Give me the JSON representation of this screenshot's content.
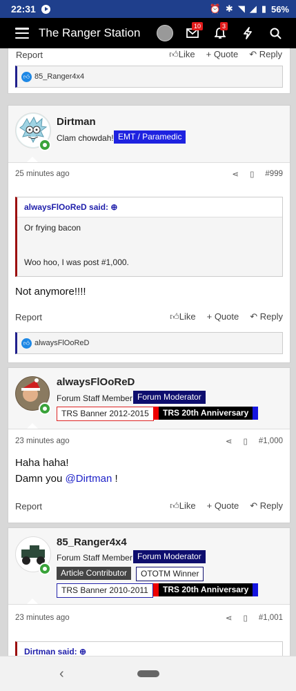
{
  "status": {
    "time": "22:31",
    "battery": "56%"
  },
  "app": {
    "title": "The Ranger Station",
    "inbox_count": "10",
    "alerts_count": "3"
  },
  "actions": {
    "report": "Report",
    "like": "Like",
    "quote": "+ Quote",
    "reply": "Reply"
  },
  "top_post": {
    "reaction_user": "85_Ranger4x4"
  },
  "post1": {
    "username": "Dirtman",
    "user_title": "Clam chowdah!",
    "banner": "EMT / Paramedic",
    "time": "25 minutes ago",
    "number": "#999",
    "quote_author": "alwaysFlOoReD said:",
    "quote_line1": "Or frying bacon",
    "quote_line2": "Woo hoo, I was post #1,000.",
    "message": "Not anymore!!!!",
    "reaction_user": "alwaysFlOoReD"
  },
  "post2": {
    "username": "alwaysFlOoReD",
    "user_title": "Forum Staff Member",
    "banner_moderator": "Forum Moderator",
    "banner_trs": "TRS Banner 2012-2015",
    "banner_anniv": "TRS 20th Anniversary",
    "time": "23 minutes ago",
    "number": "#1,000",
    "message_line1": "Haha haha!",
    "message_line2_pre": "Damn you ",
    "mention": "@Dirtman",
    "message_line2_post": " !"
  },
  "post3": {
    "username": "85_Ranger4x4",
    "user_title": "Forum Staff Member",
    "banner_moderator": "Forum Moderator",
    "banner_contributor": "Article Contributor",
    "banner_ototm": "OTOTM Winner",
    "banner_trs": "TRS Banner 2010-2011",
    "banner_anniv": "TRS 20th Anniversary",
    "time": "23 minutes ago",
    "number": "#1,001",
    "quote_author": "Dirtman said:"
  },
  "colors": {
    "accent": "#1e22e0",
    "appbar": "#000000",
    "statusbar": "#1f3f8c",
    "quote_border": "#9b0d0d"
  }
}
